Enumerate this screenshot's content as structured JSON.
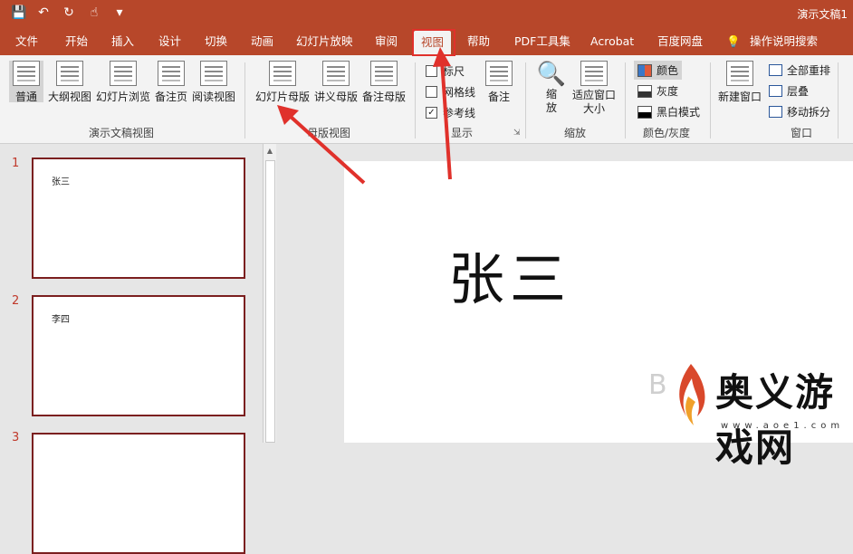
{
  "titlebar": {
    "doc_title": "演示文稿1",
    "qat": [
      "save-icon",
      "undo-icon",
      "redo-icon",
      "touch-icon",
      "customize-icon"
    ]
  },
  "tabs": [
    {
      "label": "文件"
    },
    {
      "label": "开始"
    },
    {
      "label": "插入"
    },
    {
      "label": "设计"
    },
    {
      "label": "切换"
    },
    {
      "label": "动画"
    },
    {
      "label": "幻灯片放映"
    },
    {
      "label": "审阅"
    },
    {
      "label": "视图",
      "active": true
    },
    {
      "label": "帮助"
    },
    {
      "label": "PDF工具集"
    },
    {
      "label": "Acrobat"
    },
    {
      "label": "百度网盘"
    },
    {
      "label": "操作说明搜索"
    }
  ],
  "ribbon": {
    "presentation_views": {
      "label": "演示文稿视图",
      "buttons": [
        "普通",
        "大纲视图",
        "幻灯片浏览",
        "备注页",
        "阅读视图"
      ]
    },
    "master_views": {
      "label": "母版视图",
      "buttons": [
        "幻灯片母版",
        "讲义母版",
        "备注母版"
      ]
    },
    "show": {
      "label": "显示",
      "items": [
        {
          "label": "标尺",
          "checked": false
        },
        {
          "label": "网格线",
          "checked": false
        },
        {
          "label": "参考线",
          "checked": true
        }
      ],
      "notes_button": "备注"
    },
    "zoom": {
      "label": "缩放",
      "zoom_button": "缩放",
      "fit_button": "适应窗口大小"
    },
    "color": {
      "label": "颜色/灰度",
      "options": [
        {
          "label": "颜色",
          "selected": true
        },
        {
          "label": "灰度"
        },
        {
          "label": "黑白模式"
        }
      ]
    },
    "window": {
      "label": "窗口",
      "new_window": "新建窗口",
      "arrange_all": "全部重排",
      "cascade": "层叠",
      "move_split": "移动拆分"
    }
  },
  "slides": [
    {
      "number": "1",
      "text": "张三"
    },
    {
      "number": "2",
      "text": "李四"
    },
    {
      "number": "3",
      "text": ""
    }
  ],
  "main_slide": {
    "title": "张三"
  },
  "watermark": {
    "text": "奥义游戏网",
    "url": "www.aoe1.com"
  }
}
